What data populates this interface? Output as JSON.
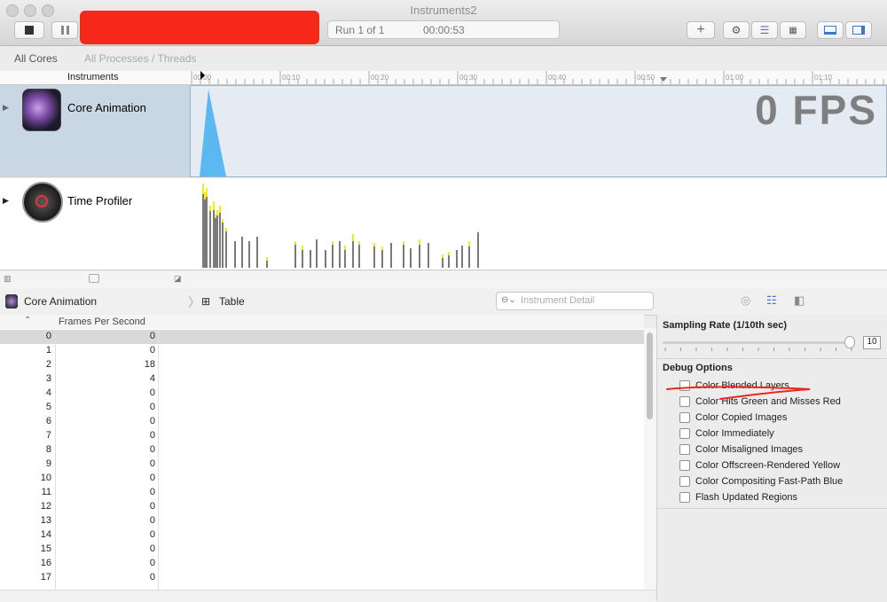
{
  "window": {
    "title": "Instruments2"
  },
  "toolbar": {
    "run_status": "Run 1 of 1",
    "elapsed": "00:00:53"
  },
  "filter": {
    "all_cores": "All Cores",
    "all_processes": "All Processes / Threads"
  },
  "timeline": {
    "header_label": "Instruments",
    "ticks": [
      "00:00",
      "00:10",
      "00:20",
      "00:30",
      "00:40",
      "00:50",
      "01:00",
      "01:10"
    ]
  },
  "tracks": [
    {
      "name": "Core Animation",
      "overlay": "0 FPS"
    },
    {
      "name": "Time Profiler"
    }
  ],
  "detail": {
    "instrument": "Core Animation",
    "view": "Table",
    "search_placeholder": "Instrument Detail",
    "columns": [
      "",
      "Frames Per Second"
    ],
    "rows": [
      [
        "0",
        "0"
      ],
      [
        "1",
        "0"
      ],
      [
        "2",
        "18"
      ],
      [
        "3",
        "4"
      ],
      [
        "4",
        "0"
      ],
      [
        "5",
        "0"
      ],
      [
        "6",
        "0"
      ],
      [
        "7",
        "0"
      ],
      [
        "8",
        "0"
      ],
      [
        "9",
        "0"
      ],
      [
        "10",
        "0"
      ],
      [
        "11",
        "0"
      ],
      [
        "12",
        "0"
      ],
      [
        "13",
        "0"
      ],
      [
        "14",
        "0"
      ],
      [
        "15",
        "0"
      ],
      [
        "16",
        "0"
      ],
      [
        "17",
        "0"
      ]
    ]
  },
  "inspector": {
    "sampling_label": "Sampling Rate (1/10th sec)",
    "sampling_value": "10",
    "debug_title": "Debug Options",
    "options": [
      "Color Blended Layers",
      "Color Hits Green and Misses Red",
      "Color Copied Images",
      "Color Immediately",
      "Color Misaligned Images",
      "Color Offscreen-Rendered Yellow",
      "Color Compositing Fast-Path Blue",
      "Flash Updated Regions"
    ]
  },
  "colors": {
    "fps_fill": "#5cb8f0",
    "annotation": "#e8281c",
    "cpu_bar": "#7a7a7a",
    "cpu_highlight": "#f5ea1a",
    "track_selected": "#c9d6e3"
  }
}
